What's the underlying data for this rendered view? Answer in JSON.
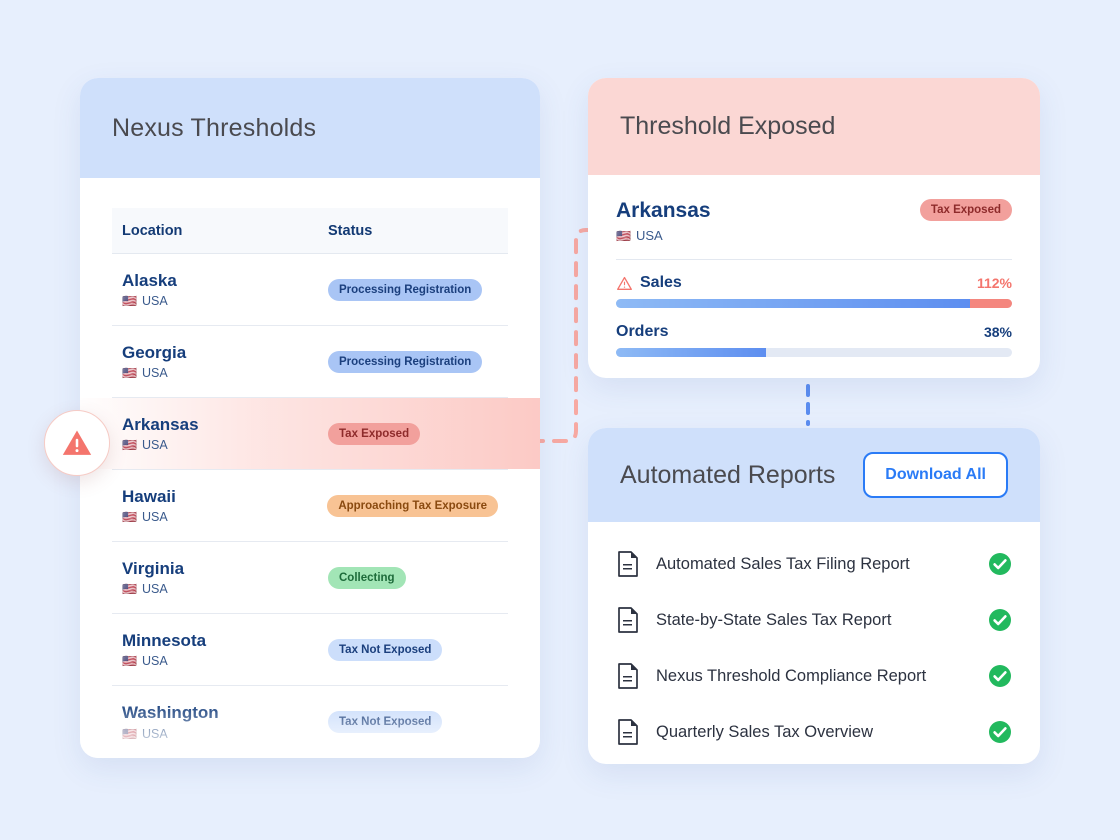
{
  "background_color": "#e7effd",
  "nexus": {
    "title": "Nexus Thresholds",
    "columns": {
      "location": "Location",
      "status": "Status"
    },
    "rows": [
      {
        "name": "Alaska",
        "country": "USA",
        "flag": "us-flag-icon",
        "status": "Processing Registration",
        "tone": "blue"
      },
      {
        "name": "Georgia",
        "country": "USA",
        "flag": "us-flag-icon",
        "status": "Processing Registration",
        "tone": "blue"
      },
      {
        "name": "Arkansas",
        "country": "USA",
        "flag": "us-flag-icon",
        "status": "Tax Exposed",
        "tone": "red"
      },
      {
        "name": "Hawaii",
        "country": "USA",
        "flag": "us-flag-icon",
        "status": "Approaching Tax Exposure",
        "tone": "orange"
      },
      {
        "name": "Virginia",
        "country": "USA",
        "flag": "us-flag-icon",
        "status": "Collecting",
        "tone": "green"
      },
      {
        "name": "Minnesota",
        "country": "USA",
        "flag": "us-flag-icon",
        "status": "Tax Not Exposed",
        "tone": "lightblue"
      },
      {
        "name": "Washington",
        "country": "USA",
        "flag": "us-flag-icon",
        "status": "Tax Not Exposed",
        "tone": "lightblue"
      }
    ],
    "alert_icon": "warning-triangle-icon"
  },
  "exposed": {
    "title": "Threshold Exposed",
    "state": "Arkansas",
    "country": "USA",
    "badge": "Tax Exposed",
    "metrics": [
      {
        "label": "Sales",
        "value": "112%",
        "percent": 112,
        "over": true,
        "icon": "warning-triangle-icon"
      },
      {
        "label": "Orders",
        "value": "38%",
        "percent": 38,
        "over": false,
        "icon": ""
      }
    ]
  },
  "reports": {
    "title": "Automated Reports",
    "download_all_label": "Download All",
    "items": [
      {
        "title": "Automated Sales Tax Filing Report",
        "icon": "document-icon",
        "status_icon": "check-circle-icon"
      },
      {
        "title": "State-by-State Sales Tax Report",
        "icon": "document-icon",
        "status_icon": "check-circle-icon"
      },
      {
        "title": "Nexus Threshold Compliance Report",
        "icon": "document-icon",
        "status_icon": "check-circle-icon"
      },
      {
        "title": "Quarterly Sales Tax Overview",
        "icon": "document-icon",
        "status_icon": "check-circle-icon"
      }
    ]
  },
  "colors": {
    "accent_blue": "#2a7bf6",
    "header_blue": "#cfe0fb",
    "header_pink": "#fbd7d4",
    "danger": "#f4756d",
    "success": "#22b95e",
    "heading_navy": "#163e7c"
  }
}
